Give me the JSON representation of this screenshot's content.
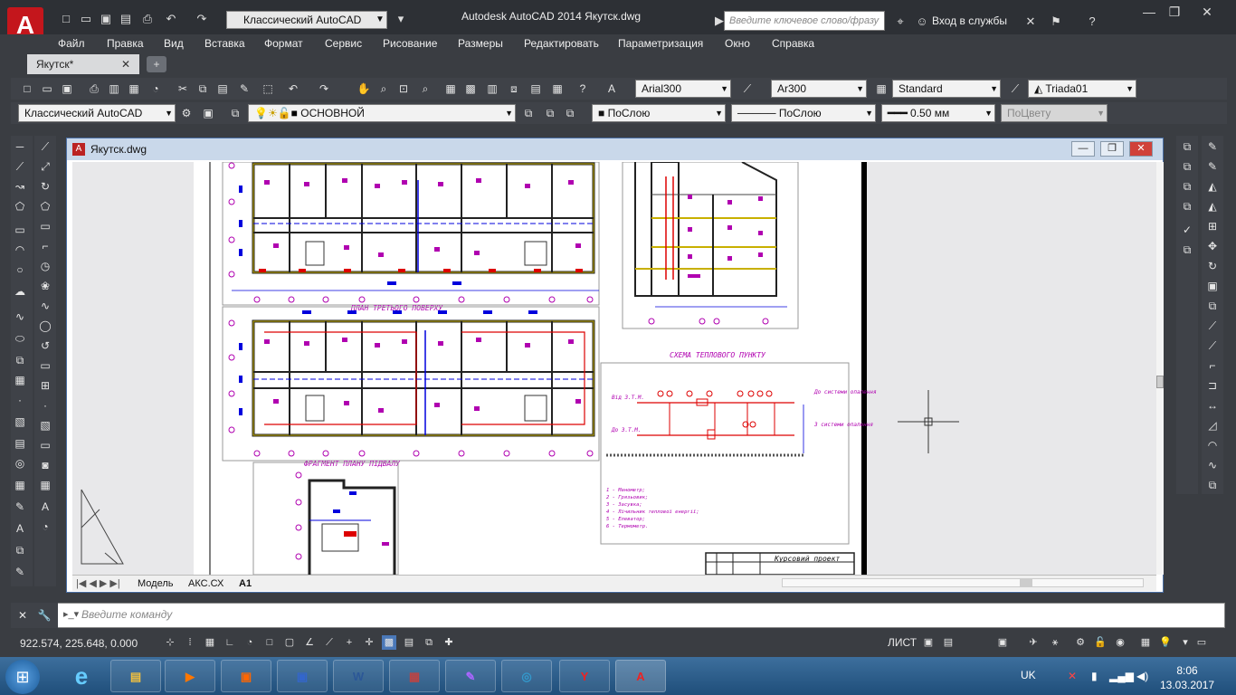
{
  "titlebar": {
    "workspace": "Классический AutoCAD",
    "app_title": "Autodesk AutoCAD 2014   Якутск.dwg",
    "search_placeholder": "Введите ключевое слово/фразу",
    "login": "Вход в службы"
  },
  "menu": [
    "Файл",
    "Правка",
    "Вид",
    "Вставка",
    "Формат",
    "Сервис",
    "Рисование",
    "Размеры",
    "Редактировать",
    "Параметризация",
    "Окно",
    "Справка"
  ],
  "file_tab": {
    "label": "Якутск*"
  },
  "toolbar": {
    "text_style": "Arial300",
    "dim_style": "Ar300",
    "table_style": "Standard",
    "multileader_style": "Triada01",
    "workspace_combo": "Классический AutoCAD",
    "layer": "ОСНОВНОЙ",
    "color": "ПоСлою",
    "linetype": "ПоСлою",
    "lineweight": "0.50 мм",
    "plotstyle": "ПоЦвету"
  },
  "drawing_window": {
    "title": "Якутск.dwg"
  },
  "drawing": {
    "label_third_floor": "ПЛАН ТРЕТЬОГО ПОВЕРХУ",
    "label_basement": "ФРАГМЕНТ ПЛАНУ ПІДВАЛУ",
    "label_heat_scheme": "СХЕМА ТЕПЛОВОГО ПУНКТУ",
    "label_from_tec": "Від З.Т.М.",
    "label_to_tec": "До З.Т.М.",
    "label_to_system": "До системи опалення",
    "label_from_system": "З системи опалення",
    "legend": [
      "1 - Манометр;",
      "2 - Грязьовик;",
      "3 - Засувка;",
      "4 - Лічильник теплової енергії;",
      "5 - Елеватор;",
      "6 - Термометр."
    ],
    "stamp": "Курсовий проект"
  },
  "layout_tabs": [
    "Модель",
    "АКС.СХ",
    "А1"
  ],
  "command": {
    "placeholder": "Введите команду"
  },
  "status": {
    "coords": "922.574, 225.648, 0.000",
    "mode": "ЛИСТ"
  },
  "taskbar": {
    "lang": "UK",
    "time": "8:06",
    "date": "13.03.2017"
  },
  "colors": {
    "accent": "#c4161c",
    "magenta": "#b000b0",
    "blue": "#0000dd",
    "red": "#dd0000"
  }
}
